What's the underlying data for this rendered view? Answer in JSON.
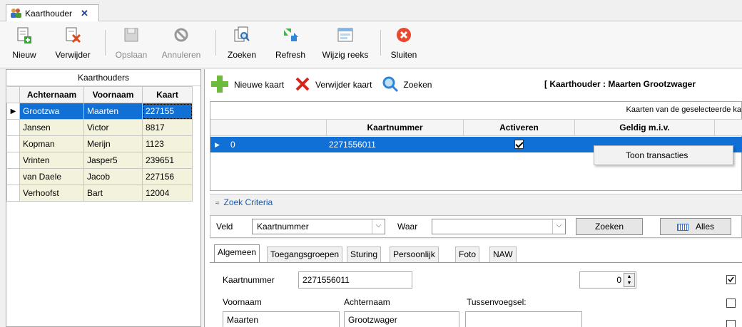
{
  "window": {
    "tab_title": "Kaarthouder",
    "tab_close": "✕"
  },
  "toolbar": {
    "items": [
      {
        "label": "Nieuw",
        "icon": "new-document-icon",
        "enabled": true
      },
      {
        "label": "Verwijder",
        "icon": "delete-document-icon",
        "enabled": true
      },
      {
        "label": "Opslaan",
        "icon": "save-icon",
        "enabled": false
      },
      {
        "label": "Annuleren",
        "icon": "cancel-icon",
        "enabled": false
      },
      {
        "label": "Zoeken",
        "icon": "search-document-icon",
        "enabled": true
      },
      {
        "label": "Refresh",
        "icon": "refresh-icon",
        "enabled": true
      },
      {
        "label": "Wijzig reeks",
        "icon": "edit-series-icon",
        "enabled": true
      },
      {
        "label": "Sluiten",
        "icon": "close-red-icon",
        "enabled": true
      }
    ]
  },
  "holders_grid": {
    "caption": "Kaarthouders",
    "columns": [
      "Achternaam",
      "Voornaam",
      "Kaart"
    ],
    "rows": [
      {
        "achternaam": "Grootzwa",
        "voornaam": "Maarten",
        "kaart": "227155",
        "selected": true
      },
      {
        "achternaam": "Jansen",
        "voornaam": "Victor",
        "kaart": "8817"
      },
      {
        "achternaam": "Kopman",
        "voornaam": "Merijn",
        "kaart": "1123"
      },
      {
        "achternaam": "Vrinten",
        "voornaam": "Jasper5",
        "kaart": "239651"
      },
      {
        "achternaam": "van Daele",
        "voornaam": "Jacob",
        "kaart": "227156"
      },
      {
        "achternaam": "Verhoofst",
        "voornaam": "Bart",
        "kaart": "12004"
      }
    ]
  },
  "card_toolbar": {
    "new_card": "Nieuwe kaart",
    "delete_card": "Verwijder kaart",
    "search": "Zoeken",
    "holder_caption": "[ Kaarthouder : Maarten Grootzwager"
  },
  "cards_grid": {
    "caption": "Kaarten van de geselecteerde ka",
    "columns": [
      "Kaartnummer",
      "Activeren",
      "Geldig m.i.v."
    ],
    "row": {
      "index": "0",
      "kaartnummer": "2271556011",
      "activeren": true
    }
  },
  "context_menu": {
    "item": "Toon transacties"
  },
  "zoek": {
    "title": "Zoek Criteria",
    "veld_label": "Veld",
    "veld_value": "Kaartnummer",
    "waar_label": "Waar",
    "waar_value": "",
    "search_button": "Zoeken",
    "all_button": "Alles"
  },
  "tabs": [
    "Algemeen",
    "Toegangsgroepen",
    "Sturing",
    "Persoonlijk",
    "Foto",
    "NAW"
  ],
  "form": {
    "kaartnummer_label": "Kaartnummer",
    "kaartnummer_value": "2271556011",
    "spinner_value": "0",
    "voornaam_label": "Voornaam",
    "voornaam_value": "Maarten",
    "achternaam_label": "Achternaam",
    "achternaam_value": "Grootzwager",
    "tussenvoegsel_label": "Tussenvoegsel:",
    "tussenvoegsel_value": ""
  }
}
